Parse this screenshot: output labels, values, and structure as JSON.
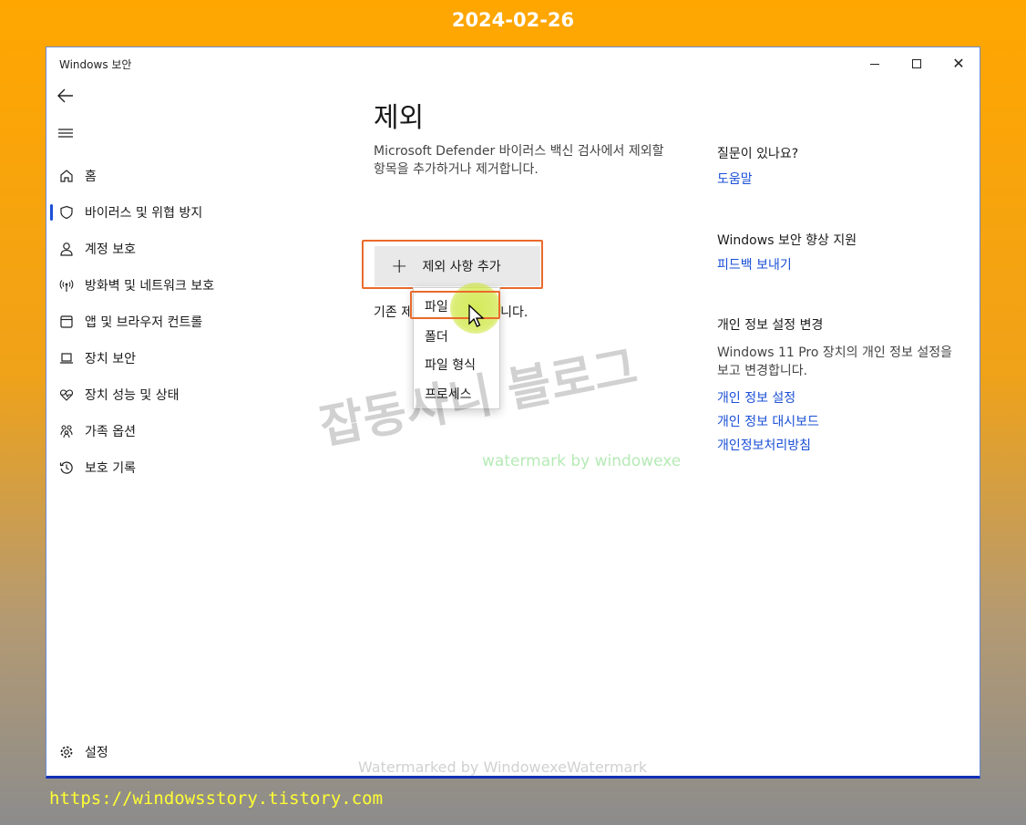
{
  "date_overlay": "2024-02-26",
  "site_url": "https://windowsstory.tistory.com",
  "window": {
    "title": "Windows 보안"
  },
  "nav": {
    "items": [
      {
        "label": "홈",
        "icon": "home-icon"
      },
      {
        "label": "바이러스 및 위협 방지",
        "icon": "shield-icon",
        "active": true
      },
      {
        "label": "계정 보호",
        "icon": "person-icon"
      },
      {
        "label": "방화벽 및 네트워크 보호",
        "icon": "antenna-icon"
      },
      {
        "label": "앱 및 브라우저 컨트롤",
        "icon": "app-window-icon"
      },
      {
        "label": "장치 보안",
        "icon": "laptop-icon"
      },
      {
        "label": "장치 성능 및 상태",
        "icon": "heart-pulse-icon"
      },
      {
        "label": "가족 옵션",
        "icon": "family-icon"
      },
      {
        "label": "보호 기록",
        "icon": "history-icon"
      }
    ],
    "settings_label": "설정"
  },
  "main": {
    "title": "제외",
    "description": "Microsoft Defender 바이러스 백신 검사에서 제외할 항목을 추가하거나 제거합니다.",
    "add_button_label": "제외 사항 추가",
    "existing_text_visible": "기존 제",
    "existing_text_end": "니다.",
    "menu_items": [
      "파일",
      "폴더",
      "파일 형식",
      "프로세스"
    ]
  },
  "side": {
    "question_heading": "질문이 있나요?",
    "help_link": "도움말",
    "improve_heading": "Windows 보안 향상 지원",
    "feedback_link": "피드백 보내기",
    "privacy_heading": "개인 정보 설정 변경",
    "privacy_desc": "Windows 11 Pro 장치의 개인 정보 설정을 보고 변경합니다.",
    "privacy_links": [
      "개인 정보 설정",
      "개인 정보 대시보드",
      "개인정보처리방침"
    ]
  },
  "watermarks": {
    "korean": "잡동사니 블로그",
    "green": "watermark by windowexe",
    "bottom": "Watermarked by WindowexeWatermark"
  },
  "colors": {
    "accent_link": "#1a4fd6",
    "highlight_outline": "#ea6a2c",
    "background_top": "#ffa600"
  }
}
